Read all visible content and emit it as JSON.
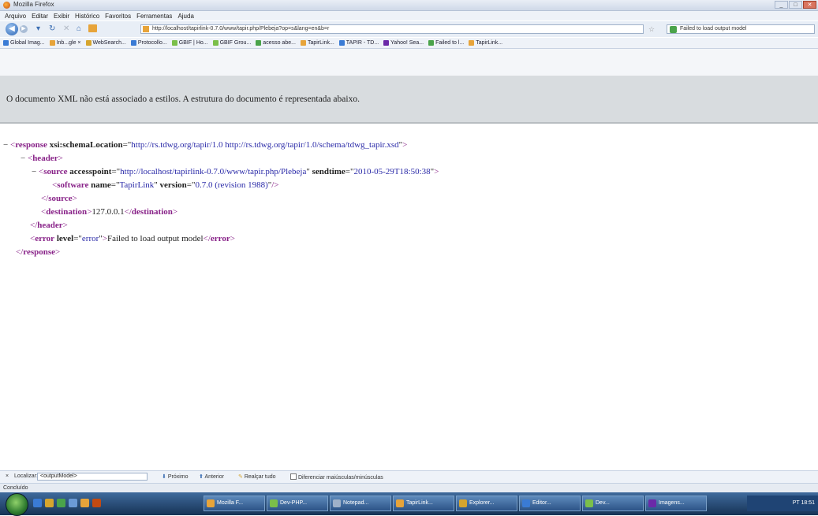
{
  "window": {
    "title": "Mozilla Firefox",
    "controls": [
      "_",
      "□",
      "✕"
    ]
  },
  "menu": [
    "Arquivo",
    "Editar",
    "Exibir",
    "Histórico",
    "Favoritos",
    "Ferramentas",
    "Ajuda"
  ],
  "nav": {
    "url": "http://localhost/tapirlink-0.7.0/www/tapir.php/Plebeja?op=s&lang=en&b=r",
    "search_value": "Failed to load output model"
  },
  "bookmarks": [
    {
      "label": "Global Imag...",
      "color": "#3a7bd5"
    },
    {
      "label": "Inb...gle  ×",
      "color": "#e7a43a"
    },
    {
      "label": "WebSearch...",
      "color": "#d6a52e"
    },
    {
      "label": "Protocollo...",
      "color": "#3a7bd5"
    },
    {
      "label": "GBIF | Ho...",
      "color": "#7bbf4a"
    },
    {
      "label": "GBIF Grou...",
      "color": "#7bbf4a"
    },
    {
      "label": "acesso abe...",
      "color": "#4aa34a"
    },
    {
      "label": "TapirLink...",
      "color": "#e7a43a"
    },
    {
      "label": "TAPIR - TD...",
      "color": "#3a7bd5"
    },
    {
      "label": "Yahoo! Sea...",
      "color": "#6b2aa8"
    },
    {
      "label": "Failed to l...",
      "color": "#4aa34a"
    },
    {
      "label": "TapirLink...",
      "color": "#e7a43a"
    }
  ],
  "banner": {
    "message": "O documento XML não está associado a estilos. A estrutura do documento é representada abaixo."
  },
  "xml": {
    "toggle": "−",
    "response_open": "response",
    "response_attr": "xsi:schemaLocation",
    "response_val": "http://rs.tdwg.org/tapir/1.0 http://rs.tdwg.org/tapir/1.0/schema/tdwg_tapir.xsd",
    "header": "header",
    "source": "source",
    "source_attr1": "accesspoint",
    "source_val1": "http://localhost/tapirlink-0.7.0/www/tapir.php/Plebeja",
    "source_attr2": "sendtime",
    "source_val2": "2010-05-29T18:50:38",
    "software": "software",
    "software_attr1": "name",
    "software_val1": "TapirLink",
    "software_attr2": "version",
    "software_val2": "0.7.0 (revision 1988)",
    "destination": "destination",
    "destination_text": "127.0.0.1",
    "error": "error",
    "error_attr": "level",
    "error_val": "error",
    "error_text": "Failed to load output model"
  },
  "findbar": {
    "close": "×",
    "label": "Localizar:",
    "value": "<outputModel>",
    "next": "Próximo",
    "prev": "Anterior",
    "highlight": "Realçar tudo",
    "match_case": "Diferenciar maiúsculas/minúsculas"
  },
  "status": "Concluído",
  "taskbar": {
    "items": [
      {
        "label": "Mozilla F...",
        "color": "#e7a43a"
      },
      {
        "label": "Dev-PHP...",
        "color": "#7bbf4a"
      },
      {
        "label": "Notepad...",
        "color": "#9fb1c9"
      },
      {
        "label": "TapirLink...",
        "color": "#e7a43a"
      },
      {
        "label": "Explorer...",
        "color": "#d6a52e"
      },
      {
        "label": "Editor...",
        "color": "#3a7bd5"
      },
      {
        "label": "Dev...",
        "color": "#7bbf4a"
      },
      {
        "label": "Imagens...",
        "color": "#6b2aa8"
      }
    ],
    "clock": "PT  18:51"
  }
}
